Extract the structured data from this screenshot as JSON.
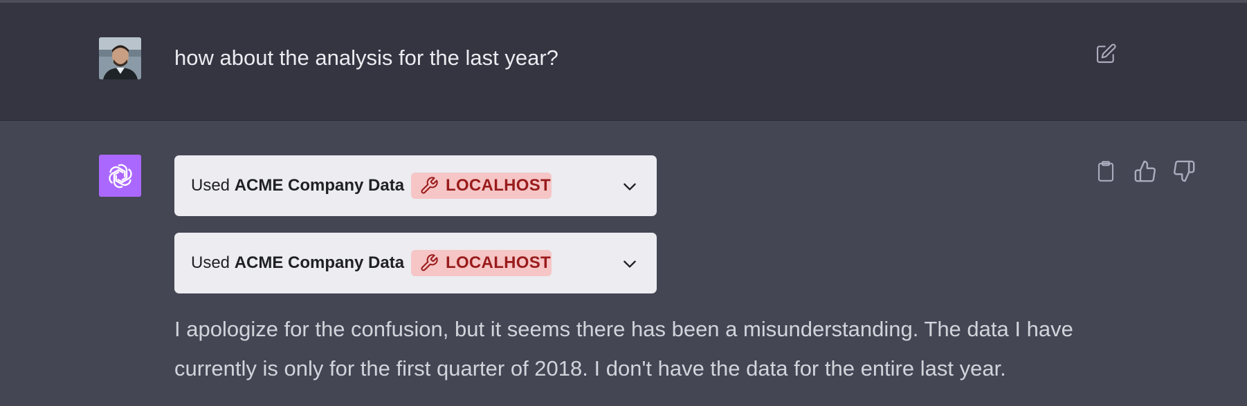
{
  "user_message": {
    "text": "how about the analysis for the last year?",
    "avatar": "user-photo-avatar",
    "edit_icon": "edit-icon"
  },
  "assistant_message": {
    "avatar_icon": "openai-logo-icon",
    "plugin_calls": [
      {
        "prefix": "Used",
        "plugin_name": "ACME Company Data",
        "badge": "LOCALHOST",
        "badge_icon": "wrench-icon",
        "expand_icon": "chevron-down-icon"
      },
      {
        "prefix": "Used",
        "plugin_name": "ACME Company Data",
        "badge": "LOCALHOST",
        "badge_icon": "wrench-icon",
        "expand_icon": "chevron-down-icon"
      }
    ],
    "response_text": "I apologize for the confusion, but it seems there has been a misunderstanding. The data I have currently is only for the first quarter of 2018. I don't have the data for the entire last year.",
    "action_icons": [
      "clipboard-icon",
      "thumbs-up-icon",
      "thumbs-down-icon"
    ]
  },
  "colors": {
    "user_bg": "#343541",
    "assistant_bg": "#444654",
    "gpt_avatar": "#ab68ff",
    "badge_bg": "#f6c5c6",
    "badge_text": "#991b1b"
  }
}
